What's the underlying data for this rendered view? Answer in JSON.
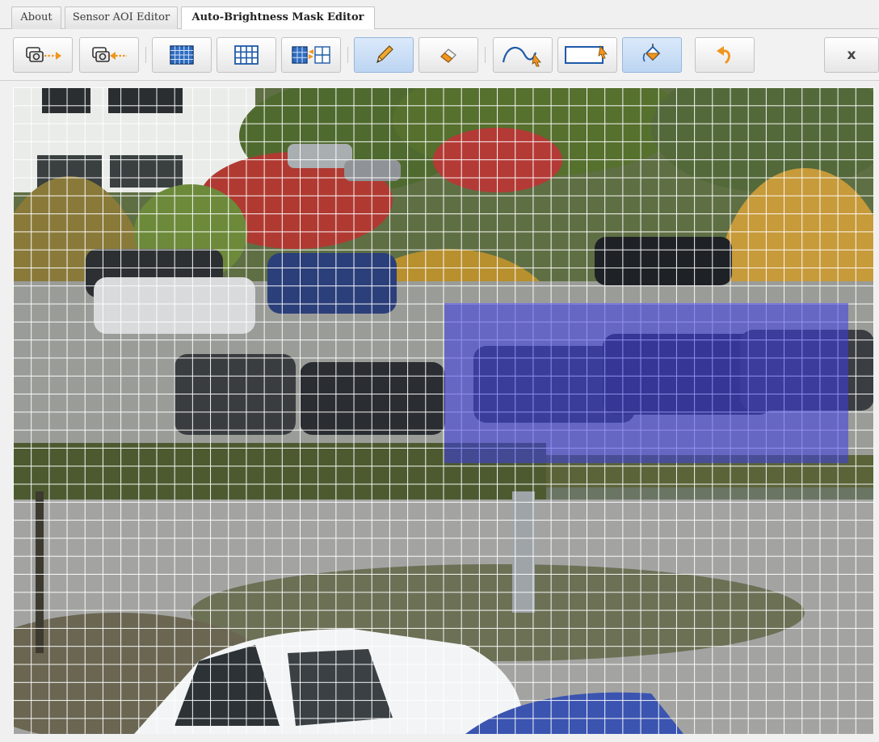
{
  "tabs": [
    {
      "label": "About"
    },
    {
      "label": "Sensor AOI Editor"
    },
    {
      "label": "Auto-Brightness Mask Editor",
      "active": true
    }
  ],
  "toolbar": {
    "close_label": "x",
    "buttons": [
      {
        "name": "copy-mask-to-button",
        "icon": "camera-arrow-right-icon"
      },
      {
        "name": "copy-mask-from-button",
        "icon": "camera-arrow-left-icon"
      },
      {
        "name": "fine-grid-button",
        "icon": "fine-grid-icon"
      },
      {
        "name": "coarse-grid-button",
        "icon": "coarse-grid-icon"
      },
      {
        "name": "grid-resize-button",
        "icon": "grid-resize-icon"
      },
      {
        "name": "pencil-tool-button",
        "icon": "pencil-icon",
        "active": true
      },
      {
        "name": "eraser-tool-button",
        "icon": "eraser-icon"
      },
      {
        "name": "freehand-select-button",
        "icon": "curve-select-icon"
      },
      {
        "name": "rectangle-select-button",
        "icon": "rectangle-select-icon"
      },
      {
        "name": "fill-tool-button",
        "icon": "paint-bucket-icon",
        "active": true
      },
      {
        "name": "undo-button",
        "icon": "undo-icon"
      },
      {
        "name": "close-button",
        "icon": "close-icon"
      }
    ]
  },
  "colors": {
    "mask": "#3c3ce6",
    "accent_orange": "#f0961e",
    "grid_blue": "#1e5aa8",
    "active_button": "#bcd5f2"
  },
  "viewport": {
    "scene": "parking-lot-camera-view",
    "mask_region": "highlighted-blue-rectangle"
  }
}
